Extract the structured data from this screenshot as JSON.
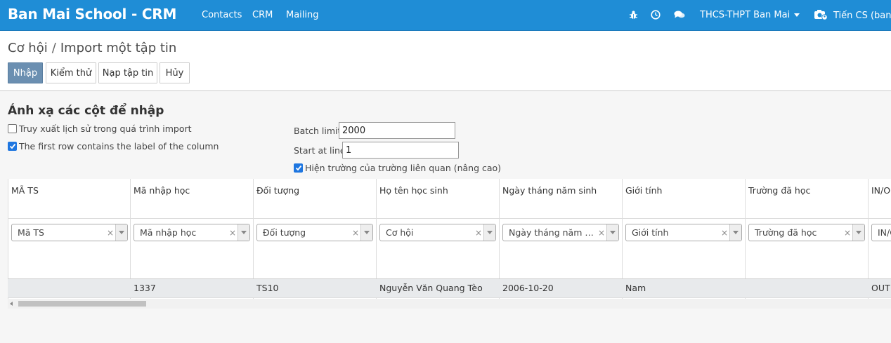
{
  "navbar": {
    "brand": "Ban Mai School - CRM",
    "links": [
      "Contacts",
      "CRM",
      "Mailing"
    ],
    "icons": [
      "bug-icon",
      "clock-icon",
      "chat-icon"
    ],
    "company": "THCS-THPT Ban Mai",
    "user": "Tiến CS (banm",
    "user_icon": "user-camera-icon"
  },
  "breadcrumb": {
    "parent": "Cơ hội",
    "separator": "/",
    "current": "Import một tập tin"
  },
  "buttons": {
    "import": "Nhập",
    "test": "Kiểm thử",
    "load": "Nạp tập tin",
    "cancel": "Hủy"
  },
  "mapping": {
    "title": "Ánh xạ các cột để nhập",
    "track_history": {
      "label": "Truy xuất lịch sử trong quá trình import",
      "checked": false
    },
    "header_row": {
      "label": "The first row contains the label of the column",
      "checked": true
    },
    "batch_limit_label": "Batch limit",
    "batch_limit": "2000",
    "start_line_label": "Start at line",
    "start_line": "1",
    "show_related": {
      "label": "Hiện trường của trường liên quan (nâng cao)",
      "checked": true
    }
  },
  "columns": [
    {
      "header": "MÃ TS",
      "field": "Mã TS",
      "value": ""
    },
    {
      "header": "Mã nhập học",
      "field": "Mã nhập học",
      "value": "1337"
    },
    {
      "header": "Đối tượng",
      "field": "Đối tượng",
      "value": "TS10"
    },
    {
      "header": "Họ tên học sinh",
      "field": "Cơ hội",
      "value": "Nguyễn Văn Quang Tèo"
    },
    {
      "header": "Ngày tháng năm sinh",
      "field": "Ngày tháng năm sinh",
      "value": "2006-10-20"
    },
    {
      "header": "Giới tính",
      "field": "Giới tính",
      "value": "Nam"
    },
    {
      "header": "Trường đã học",
      "field": "Trường đã học",
      "value": ""
    },
    {
      "header": "IN/OUT",
      "field": "IN/OUT",
      "value": "OUT"
    }
  ],
  "colors": {
    "navbar": "#1f8dd6",
    "primary_button": "#6b8fb1",
    "checkbox": "#1e76e0"
  }
}
